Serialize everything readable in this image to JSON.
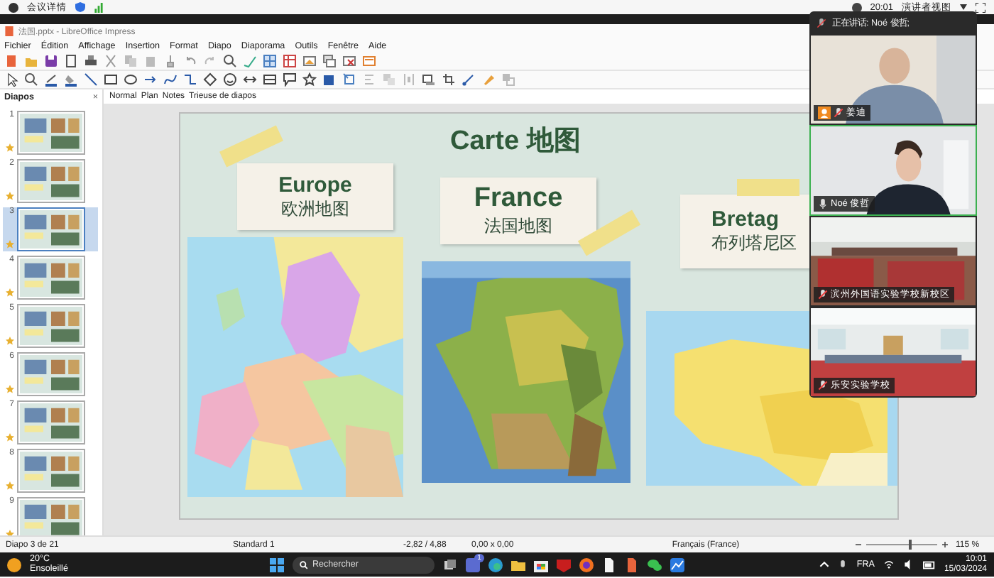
{
  "meeting_bar": {
    "title": "会议详情",
    "time": "20:01",
    "view_button": "演讲者视图"
  },
  "window": {
    "title": "法国.pptx - LibreOffice Impress"
  },
  "menu": [
    "Fichier",
    "Édition",
    "Affichage",
    "Insertion",
    "Format",
    "Diapo",
    "Diaporama",
    "Outils",
    "Fenêtre",
    "Aide"
  ],
  "slides_panel": {
    "title": "Diapos",
    "close": "×",
    "slides": [
      {
        "number": "1",
        "selected": false
      },
      {
        "number": "2",
        "selected": false
      },
      {
        "number": "3",
        "selected": true
      },
      {
        "number": "4",
        "selected": false
      },
      {
        "number": "5",
        "selected": false
      },
      {
        "number": "6",
        "selected": false
      },
      {
        "number": "7",
        "selected": false
      },
      {
        "number": "8",
        "selected": false
      },
      {
        "number": "9",
        "selected": false
      }
    ]
  },
  "view_tabs": [
    "Normal",
    "Plan",
    "Notes",
    "Trieuse de diapos"
  ],
  "slide": {
    "title": "Carte  地图",
    "cards": [
      {
        "title": "Europe",
        "subtitle": "欧洲地图"
      },
      {
        "title": "France",
        "subtitle": "法国地图"
      },
      {
        "title": "Bretag",
        "subtitle": "布列塔尼区"
      }
    ]
  },
  "video_panel": {
    "speaking": "正在讲话:  Noé 俊哲;",
    "tiles": [
      {
        "name": "姜迪",
        "host": true,
        "muted": true,
        "selected": false
      },
      {
        "name": "Noé 俊哲",
        "host": false,
        "muted": false,
        "selected": true
      },
      {
        "name": "滨州外国语实验学校新校区",
        "host": false,
        "muted": true,
        "selected": false
      },
      {
        "name": "乐安实验学校",
        "host": false,
        "muted": true,
        "selected": false
      }
    ]
  },
  "status_bar": {
    "slide": "Diapo 3 de 21",
    "layout": "Standard 1",
    "position": "-2,82 / 4,88",
    "size": "0,00 x 0,00",
    "language": "Français (France)",
    "zoom_slider": {
      "level": 0.6
    },
    "zoom": "115 %"
  },
  "taskbar": {
    "temperature": "20°C",
    "weather": "Ensoleillé",
    "search_placeholder": "Rechercher",
    "badge": "1",
    "language": "FRA",
    "time": "10:01",
    "date": "15/03/2024"
  }
}
